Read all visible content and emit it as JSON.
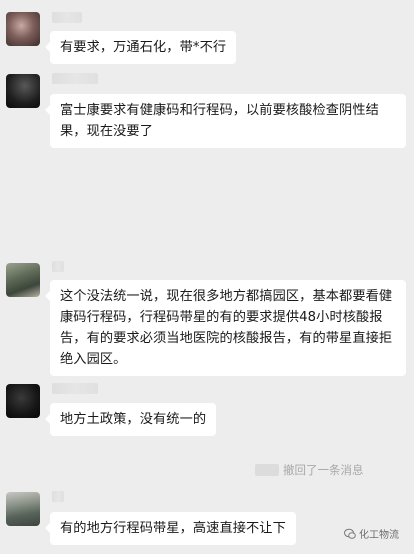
{
  "messages": [
    {
      "text": "有要求，万通石化，带*不行"
    },
    {
      "text": "富士康要求有健康码和行程码，以前要核酸检查阴性结果，现在没要了"
    },
    {
      "text": "这个没法统一说，现在很多地方都搞园区，基本都要看健康码行程码，行程码带星的有的要求提供48小时核酸报告，有的要求必须当地医院的核酸报告，有的带星直接拒绝入园区。"
    },
    {
      "text": "地方土政策，没有统一的"
    },
    {
      "text": "有的地方行程码带星，高速直接不让下"
    }
  ],
  "system_notice": {
    "text": "撤回了一条消息"
  },
  "watermark": {
    "text": "化工物流"
  }
}
